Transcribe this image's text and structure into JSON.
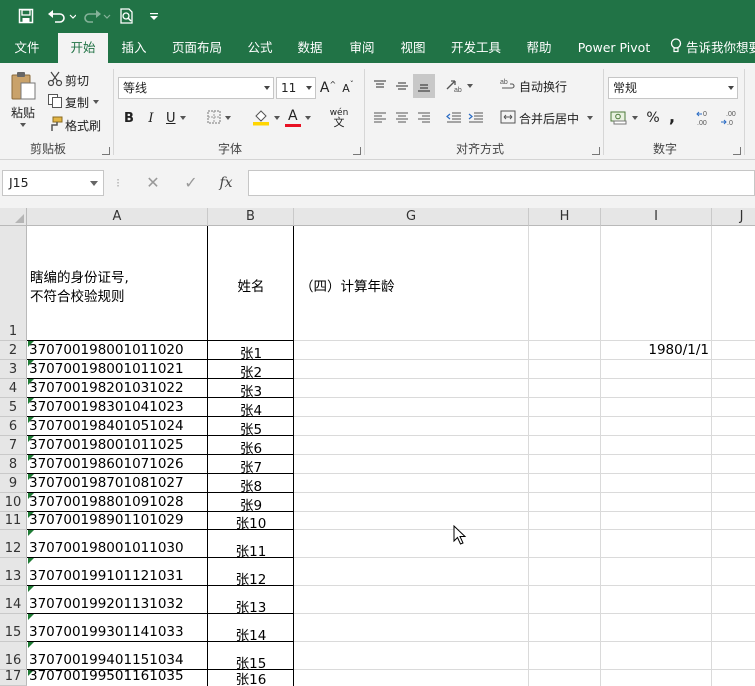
{
  "ribbon_tabs": [
    "文件",
    "开始",
    "插入",
    "页面布局",
    "公式",
    "数据",
    "审阅",
    "视图",
    "开发工具",
    "帮助",
    "Power Pivot"
  ],
  "active_tab": "开始",
  "tell_me": "告诉我你想要",
  "clipboard": {
    "paste": "粘贴",
    "cut": "剪切",
    "copy": "复制",
    "format_painter": "格式刷",
    "group_label": "剪贴板"
  },
  "font": {
    "name": "等线",
    "size": "11",
    "grow": "A",
    "shrink": "A",
    "bold": "B",
    "italic": "I",
    "underline": "U",
    "color_letter": "A",
    "phonetic": "wén",
    "group_label": "字体"
  },
  "alignment": {
    "wrap_text": "自动换行",
    "merge_center": "合并后居中",
    "group_label": "对齐方式"
  },
  "number": {
    "format": "常规",
    "percent": "%",
    "comma": ",",
    "group_label": "数字"
  },
  "formula_bar": {
    "name_box": "J15",
    "cancel": "✕",
    "enter": "✓",
    "fx": "fx",
    "formula": ""
  },
  "sheet": {
    "columns": [
      "A",
      "B",
      "G",
      "H",
      "I",
      "J"
    ],
    "row_numbers": [
      "1",
      "2",
      "3",
      "4",
      "5",
      "6",
      "7",
      "8",
      "9",
      "10",
      "11",
      "12",
      "13",
      "14",
      "15",
      "16",
      "17"
    ],
    "header_a_line1": "瞎编的身份证号,",
    "header_a_line2": "不符合校验规则",
    "header_b": "姓名",
    "header_g": "（四）计算年龄",
    "i2_value": "1980/1/1",
    "rows": [
      {
        "id": "370700198001011020",
        "name": "张1"
      },
      {
        "id": "370700198001011021",
        "name": "张2"
      },
      {
        "id": "370700198201031022",
        "name": "张3"
      },
      {
        "id": "370700198301041023",
        "name": "张4"
      },
      {
        "id": "370700198401051024",
        "name": "张5"
      },
      {
        "id": "370700198001011025",
        "name": "张6"
      },
      {
        "id": "370700198601071026",
        "name": "张7"
      },
      {
        "id": "370700198701081027",
        "name": "张8"
      },
      {
        "id": "370700198801091028",
        "name": "张9"
      },
      {
        "id": "370700198901101029",
        "name": "张10"
      },
      {
        "id": "370700198001011030",
        "name": "张11"
      },
      {
        "id": "370700199101121031",
        "name": "张12"
      },
      {
        "id": "370700199201131032",
        "name": "张13"
      },
      {
        "id": "370700199301141033",
        "name": "张14"
      },
      {
        "id": "370700199401151034",
        "name": "张15"
      },
      {
        "id": "370700199501161035",
        "name": "张16"
      }
    ]
  }
}
